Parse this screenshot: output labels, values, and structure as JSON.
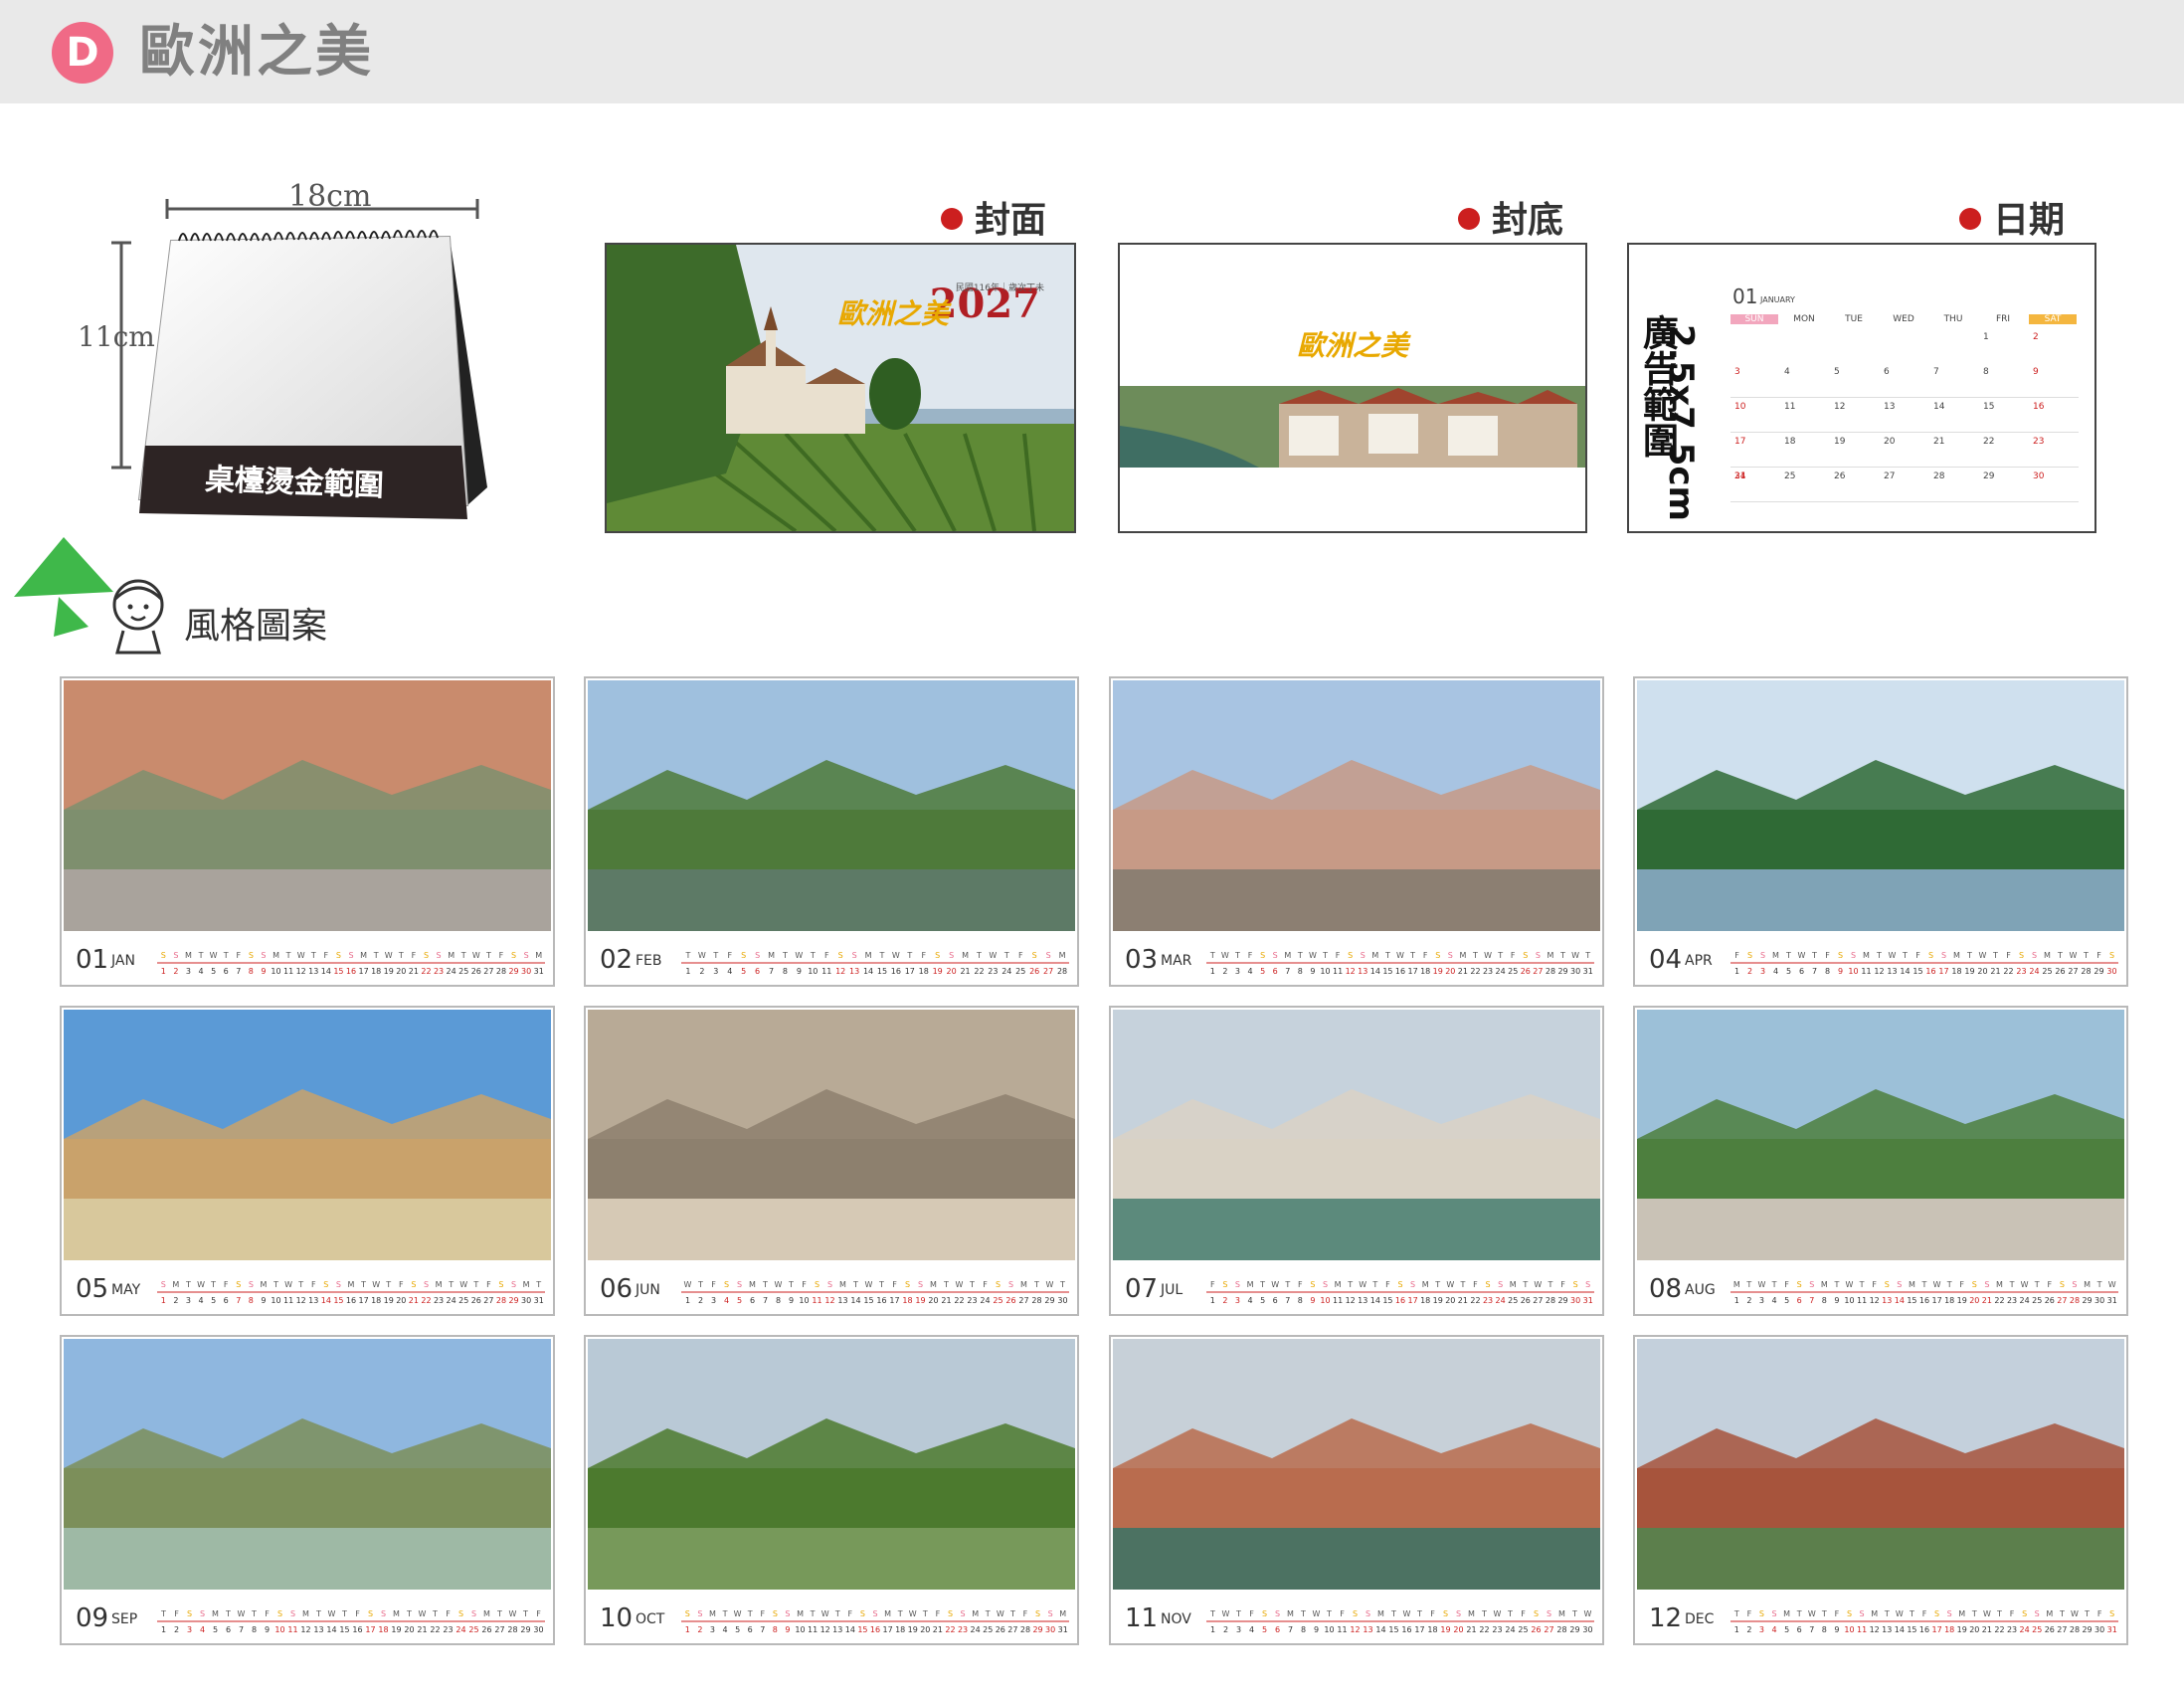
{
  "header": {
    "badge": "D",
    "title": "歐洲之美"
  },
  "desk": {
    "width_label": "18cm",
    "height_label": "11cm",
    "foil_label": "桌檯燙金範圍"
  },
  "labels": {
    "cover": "封面",
    "back": "封底",
    "date": "日期",
    "style": "風格圖案"
  },
  "cover": {
    "title": "歐洲之美",
    "year": "2027",
    "small": "民國116年｜歲次丁未"
  },
  "back": {
    "title": "歐洲之美"
  },
  "date": {
    "ad_size": "2.5x7.5cm",
    "ad_label": "廣告範圍",
    "month_num": "01",
    "month_en": "JANUARY",
    "weekdays": [
      "SUN",
      "MON",
      "TUE",
      "WED",
      "THU",
      "FRI",
      "SAT"
    ]
  },
  "colors": {
    "accent": "#cc1f1f",
    "header_bg": "#e9e9e9",
    "badge": "#f06a86",
    "gold": "#e8a800",
    "year": "#b01e23"
  },
  "months": [
    {
      "num": "01",
      "name": "JAN",
      "start": 5,
      "days": 31
    },
    {
      "num": "02",
      "name": "FEB",
      "start": 1,
      "days": 28
    },
    {
      "num": "03",
      "name": "MAR",
      "start": 1,
      "days": 31
    },
    {
      "num": "04",
      "name": "APR",
      "start": 4,
      "days": 30
    },
    {
      "num": "05",
      "name": "MAY",
      "start": 6,
      "days": 31
    },
    {
      "num": "06",
      "name": "JUN",
      "start": 2,
      "days": 30
    },
    {
      "num": "07",
      "name": "JUL",
      "start": 4,
      "days": 31
    },
    {
      "num": "08",
      "name": "AUG",
      "start": 0,
      "days": 31
    },
    {
      "num": "09",
      "name": "SEP",
      "start": 3,
      "days": 30
    },
    {
      "num": "10",
      "name": "OCT",
      "start": 5,
      "days": 31
    },
    {
      "num": "11",
      "name": "NOV",
      "start": 1,
      "days": 30
    },
    {
      "num": "12",
      "name": "DEC",
      "start": 3,
      "days": 31
    }
  ]
}
